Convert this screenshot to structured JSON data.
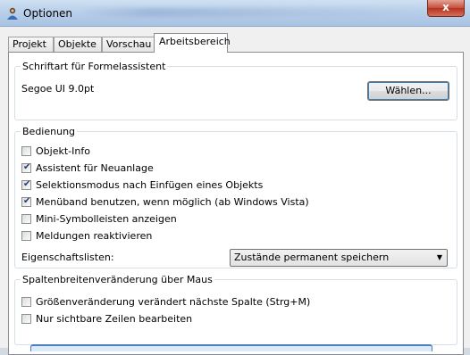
{
  "window": {
    "title": "Optionen",
    "close_label": "x"
  },
  "tabs": [
    "Projekt",
    "Objekte",
    "Vorschau",
    "Arbeitsbereich"
  ],
  "font_group": {
    "legend": "Schriftart für Formelassistent",
    "value": "Segoe UI 9.0pt",
    "button": "Wählen..."
  },
  "bedienung": {
    "legend": "Bedienung",
    "items": [
      {
        "label": "Objekt-Info",
        "checked": false
      },
      {
        "label": "Assistent für Neuanlage",
        "checked": true
      },
      {
        "label": "Selektionsmodus nach Einfügen eines Objekts",
        "checked": true
      },
      {
        "label": "Menüband benutzen, wenn möglich (ab Windows Vista)",
        "checked": true
      },
      {
        "label": "Mini-Symbolleisten anzeigen",
        "checked": false
      },
      {
        "label": "Meldungen reaktivieren",
        "checked": false
      }
    ],
    "property_label": "Eigenschaftslisten:",
    "property_value": "Zustände permanent speichern"
  },
  "spalten": {
    "legend": "Spaltenbreitenveränderung über Maus",
    "items": [
      {
        "label": "Größenveränderung verändert nächste Spalte (Strg+M)",
        "checked": false
      },
      {
        "label": "Nur sichtbare Zeilen bearbeiten",
        "checked": false
      }
    ]
  }
}
